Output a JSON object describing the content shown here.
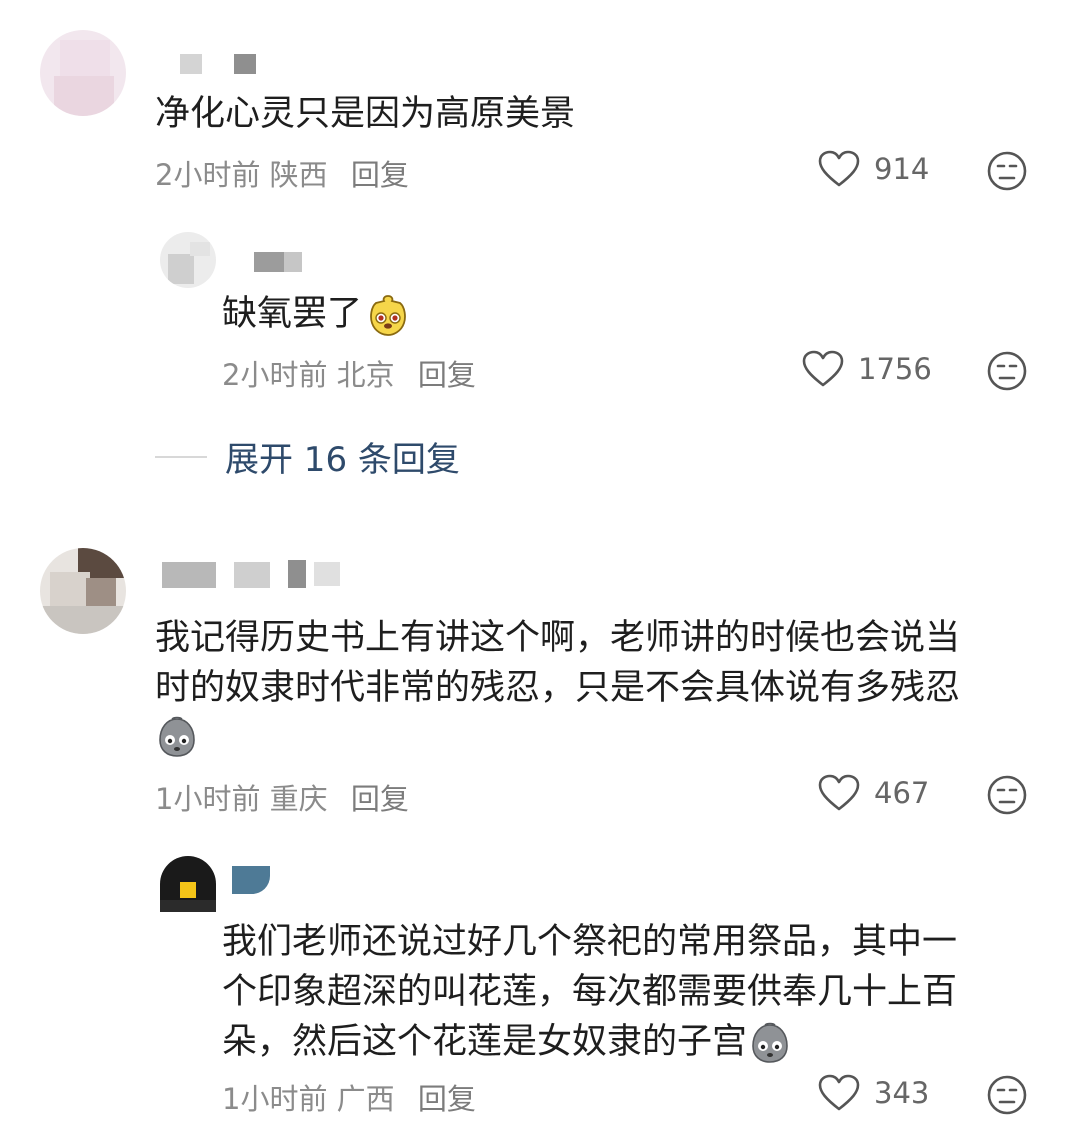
{
  "comments": [
    {
      "text": "净化心灵只是因为高原美景",
      "time": "2小时前",
      "location": "陕西",
      "reply_label": "回复",
      "likes": "914",
      "replies": [
        {
          "text": "缺氧罢了",
          "emoji": "yellow-mascot-emoji",
          "time": "2小时前",
          "location": "北京",
          "reply_label": "回复",
          "likes": "1756"
        }
      ],
      "expand_label": "展开 16 条回复"
    },
    {
      "text_lines": [
        "我记得历史书上有讲这个啊，老师讲的时候也会说当",
        "时的奴隶时代非常的残忍，只是不会具体说有多残忍"
      ],
      "emoji": "gray-sad-emoji",
      "time": "1小时前",
      "location": "重庆",
      "reply_label": "回复",
      "likes": "467",
      "replies": [
        {
          "text_lines": [
            "我们老师还说过好几个祭祀的常用祭品，其中一",
            "个印象超深的叫花莲，每次都需要供奉几十上百",
            "朵，然后这个花莲是女奴隶的子宫"
          ],
          "emoji": "gray-sad-emoji",
          "time": "1小时前",
          "location": "广西",
          "reply_label": "回复",
          "likes": "343"
        }
      ]
    }
  ],
  "colors": {
    "text": "#1e1e1e",
    "meta": "#8b8b8b",
    "expand": "#2e4a6b",
    "icon": "#555555"
  }
}
